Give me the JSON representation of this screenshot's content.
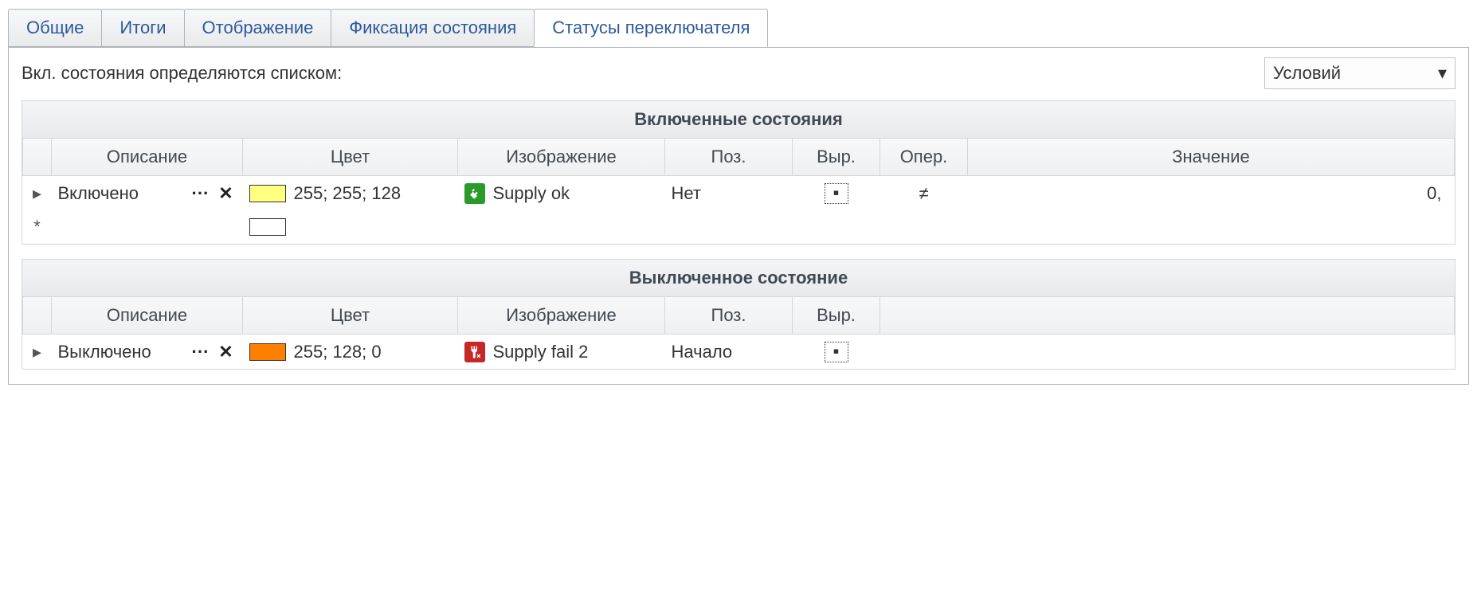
{
  "tabs": {
    "general": "Общие",
    "totals": "Итоги",
    "display": "Отображение",
    "state_fix": "Фиксация состояния",
    "switch_statuses": "Статусы переключателя"
  },
  "page": {
    "intro_label": "Вкл. состояния определяются списком:",
    "combo_value": "Условий"
  },
  "on_grid": {
    "title": "Включенные состояния",
    "headers": {
      "desc": "Описание",
      "color": "Цвет",
      "image": "Изображение",
      "pos": "Поз.",
      "expr": "Выр.",
      "oper": "Опер.",
      "value": "Значение"
    },
    "row": {
      "desc": "Включено",
      "color_text": "255; 255; 128",
      "color_hex": "#ffff80",
      "image_text": "Supply ok",
      "image_bg": "#2a9b2a",
      "pos": "Нет",
      "expr_glyph": "▪",
      "oper": "≠",
      "value": "0,"
    },
    "new_row_glyph": "*",
    "row_glyph": "▸"
  },
  "off_grid": {
    "title": "Выключенное состояние",
    "headers": {
      "desc": "Описание",
      "color": "Цвет",
      "image": "Изображение",
      "pos": "Поз.",
      "expr": "Выр."
    },
    "row": {
      "desc": "Выключено",
      "color_text": "255; 128; 0",
      "color_hex": "#ff8000",
      "image_text": "Supply fail 2",
      "image_bg": "#c62828",
      "pos": "Начало",
      "expr_glyph": "▪"
    },
    "row_glyph": "▸"
  },
  "glyphs": {
    "ellipsis": "···",
    "close_x": "✕",
    "dropdown": "▾"
  }
}
